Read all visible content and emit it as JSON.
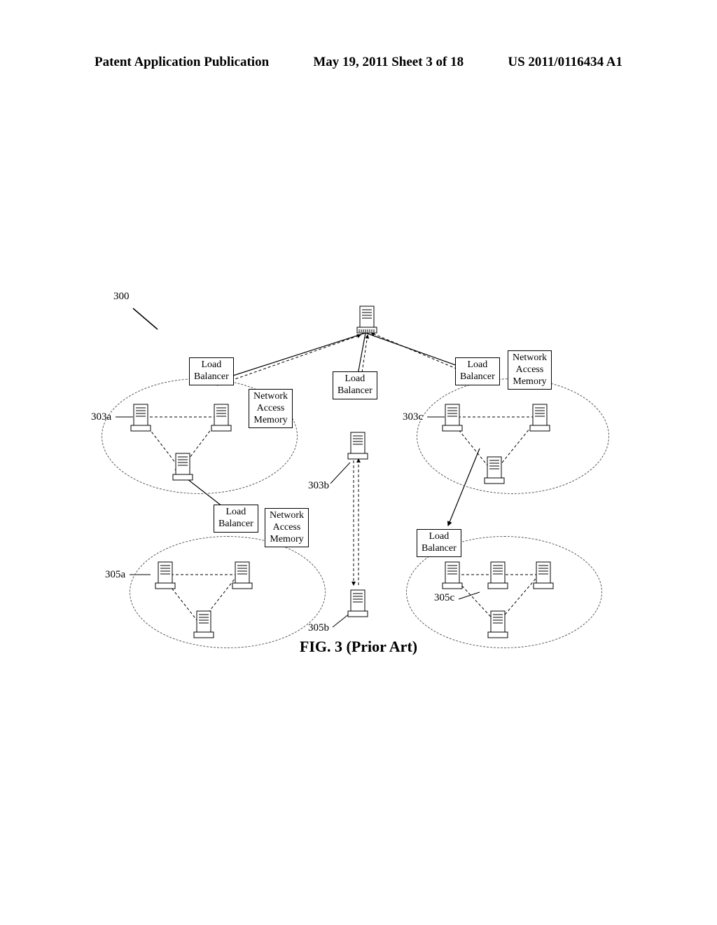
{
  "header": {
    "left": "Patent Application Publication",
    "center": "May 19, 2011  Sheet 3 of 18",
    "right": "US 2011/0116434 A1"
  },
  "diagram": {
    "root_label": "300",
    "boxes": {
      "lb": "Load\nBalancer",
      "nam": "Network\nAccess\nMemory"
    },
    "cluster_labels": {
      "top_left": "303a",
      "top_mid": "303b",
      "top_right": "303c",
      "bot_left": "305a",
      "bot_mid": "305b",
      "bot_right": "305c"
    }
  },
  "caption": "FIG. 3 (Prior Art)"
}
